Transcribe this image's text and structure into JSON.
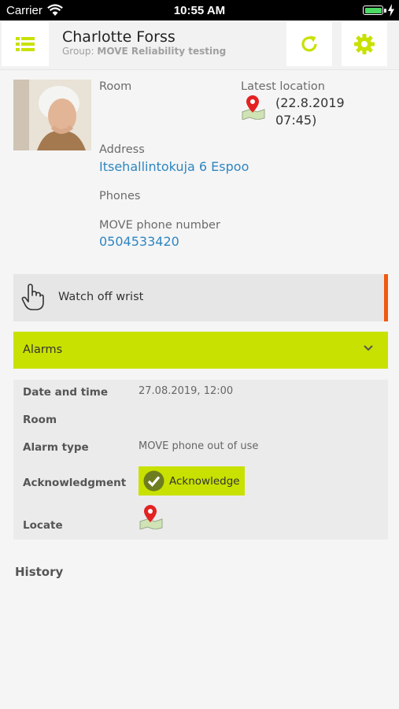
{
  "status_bar": {
    "carrier": "Carrier",
    "time": "10:55 AM",
    "battery_color": "#4cd964"
  },
  "header": {
    "name": "Charlotte Forss",
    "group_label": "Group:",
    "group_name": "MOVE Reliability testing",
    "menu_icon": "list-icon",
    "refresh_icon": "refresh-icon",
    "settings_icon": "gear-icon",
    "accent_color": "#c8e100"
  },
  "profile": {
    "room_label": "Room",
    "latest_location_label": "Latest location",
    "latest_location_value": "(22.8.2019 07:45)",
    "address_label": "Address",
    "address_value": "Itsehallintokuja 6 Espoo",
    "phones_label": "Phones",
    "move_phone_label": "MOVE phone number",
    "move_phone_value": "0504533420"
  },
  "notice": {
    "label": "Watch off wrist",
    "icon": "hand-pointer-icon",
    "marker_color": "#f05a0f"
  },
  "alarms": {
    "section_title": "Alarms",
    "fields": {
      "date_label": "Date and time",
      "date_value": "27.08.2019, 12:00",
      "room_label": "Room",
      "room_value": "",
      "type_label": "Alarm type",
      "type_value": "MOVE phone out of use",
      "ack_label": "Acknowledgment",
      "ack_button": "Acknowledge",
      "locate_label": "Locate"
    }
  },
  "history": {
    "title": "History"
  }
}
